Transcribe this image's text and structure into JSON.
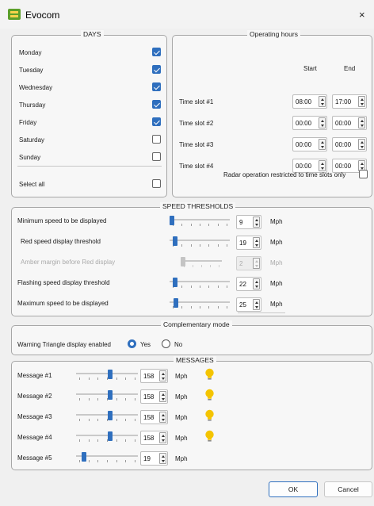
{
  "window": {
    "title": "Evocom",
    "close_glyph": "×",
    "icon": "evocom-app-icon"
  },
  "days": {
    "legend": "DAYS",
    "items": [
      {
        "label": "Monday",
        "checked": true
      },
      {
        "label": "Tuesday",
        "checked": true
      },
      {
        "label": "Wednesday",
        "checked": true
      },
      {
        "label": "Thursday",
        "checked": true
      },
      {
        "label": "Friday",
        "checked": true
      },
      {
        "label": "Saturday",
        "checked": false
      },
      {
        "label": "Sunday",
        "checked": false
      }
    ],
    "select_all_label": "Select all",
    "select_all_checked": false
  },
  "operating_hours": {
    "legend": "Operating hours",
    "start_header": "Start",
    "end_header": "End",
    "slots": [
      {
        "label": "Time slot #1",
        "start": "08:00",
        "end": "17:00"
      },
      {
        "label": "Time slot #2",
        "start": "00:00",
        "end": "00:00"
      },
      {
        "label": "Time slot #3",
        "start": "00:00",
        "end": "00:00"
      },
      {
        "label": "Time slot #4",
        "start": "00:00",
        "end": "00:00"
      }
    ],
    "radar_label": "Radar operation restricted to time slots only",
    "radar_checked": false
  },
  "speed_thresholds": {
    "legend": "SPEED THRESHOLDS",
    "unit": "Mph",
    "rows": [
      {
        "label": "Minimum speed to be displayed",
        "value": "9",
        "slider_fraction": 0.0,
        "enabled": true
      },
      {
        "label": "Red speed display threshold",
        "value": "19",
        "slider_fraction": 0.05,
        "enabled": true
      },
      {
        "label": "Amber margin before Red display",
        "value": "2",
        "slider_fraction": 0.0,
        "enabled": false
      },
      {
        "label": "Flashing speed display threshold",
        "value": "22",
        "slider_fraction": 0.06,
        "enabled": true
      },
      {
        "label": "Maximum speed to be displayed",
        "value": "25",
        "slider_fraction": 0.07,
        "enabled": true
      }
    ]
  },
  "complementary_mode": {
    "legend": "Complementary mode",
    "warning_label": "Warning Triangle display enabled",
    "yes_label": "Yes",
    "no_label": "No",
    "selected": "Yes"
  },
  "messages": {
    "legend": "MESSAGES",
    "unit": "Mph",
    "rows": [
      {
        "label": "Message #1",
        "value": "158",
        "slider_fraction": 0.55,
        "bulb": true
      },
      {
        "label": "Message #2",
        "value": "158",
        "slider_fraction": 0.55,
        "bulb": true
      },
      {
        "label": "Message #3",
        "value": "158",
        "slider_fraction": 0.55,
        "bulb": true
      },
      {
        "label": "Message #4",
        "value": "158",
        "slider_fraction": 0.55,
        "bulb": true
      },
      {
        "label": "Message #5",
        "value": "19",
        "slider_fraction": 0.1,
        "bulb": false
      }
    ]
  },
  "buttons": {
    "ok": "OK",
    "cancel": "Cancel"
  },
  "colors": {
    "accent": "#2f6fbe",
    "bulb": "#f4c400",
    "app_icon": "#5c9f2a"
  }
}
